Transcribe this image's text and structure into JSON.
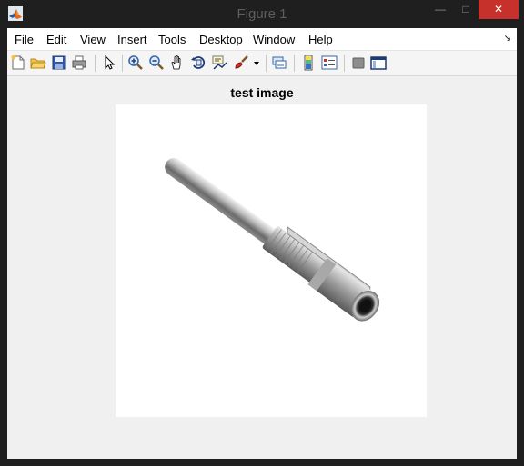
{
  "window": {
    "title": "Figure 1",
    "min_label": "—",
    "max_label": "□",
    "close_label": "✕"
  },
  "menubar": {
    "items": [
      "File",
      "Edit",
      "View",
      "Insert",
      "Tools",
      "Desktop",
      "Window",
      "Help"
    ],
    "dock_arrow": "↘"
  },
  "toolbar": {
    "icons": [
      "new-figure-icon",
      "open-file-icon",
      "save-figure-icon",
      "print-figure-icon",
      "edit-plot-arrow-icon",
      "zoom-in-icon",
      "zoom-out-icon",
      "pan-hand-icon",
      "rotate-3d-icon",
      "data-cursor-icon",
      "brush-icon",
      "brush-dropdown-icon",
      "link-plot-icon",
      "insert-colorbar-icon",
      "insert-legend-icon",
      "hide-plot-tools-icon",
      "show-plot-tools-icon"
    ]
  },
  "figure": {
    "title": "test image",
    "image_subject": "pen"
  }
}
